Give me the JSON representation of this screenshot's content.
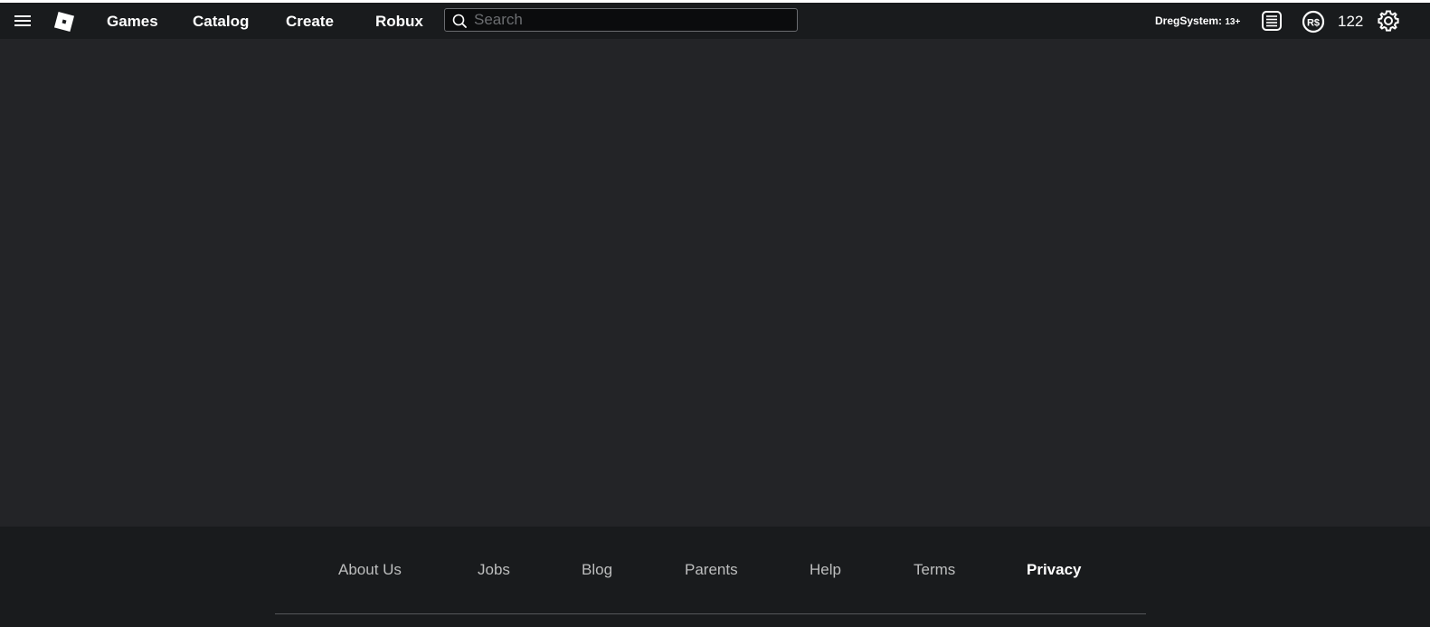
{
  "nav": {
    "links": [
      {
        "label": "Games"
      },
      {
        "label": "Catalog"
      },
      {
        "label": "Create"
      },
      {
        "label": "Robux"
      }
    ],
    "search": {
      "placeholder": "Search",
      "value": ""
    },
    "icons": {
      "menu": "hamburger-menu-icon",
      "logo": "roblox-logo",
      "search": "search-icon",
      "notifications": "notifications-icon",
      "robux": "robux-icon",
      "settings": "gear-icon"
    },
    "user": {
      "name": "DregSystem:",
      "age_tag": "13+"
    },
    "robux_count": "122"
  },
  "footer": {
    "links": [
      {
        "label": "About Us"
      },
      {
        "label": "Jobs"
      },
      {
        "label": "Blog"
      },
      {
        "label": "Parents"
      },
      {
        "label": "Help"
      },
      {
        "label": "Terms"
      },
      {
        "label": "Privacy"
      }
    ],
    "active": "Privacy"
  },
  "colors": {
    "nav_background": "#191b1d",
    "page_background": "#232427",
    "footer_background": "#191b1d",
    "text_primary": "#ffffff",
    "text_secondary": "#bdbebe"
  }
}
